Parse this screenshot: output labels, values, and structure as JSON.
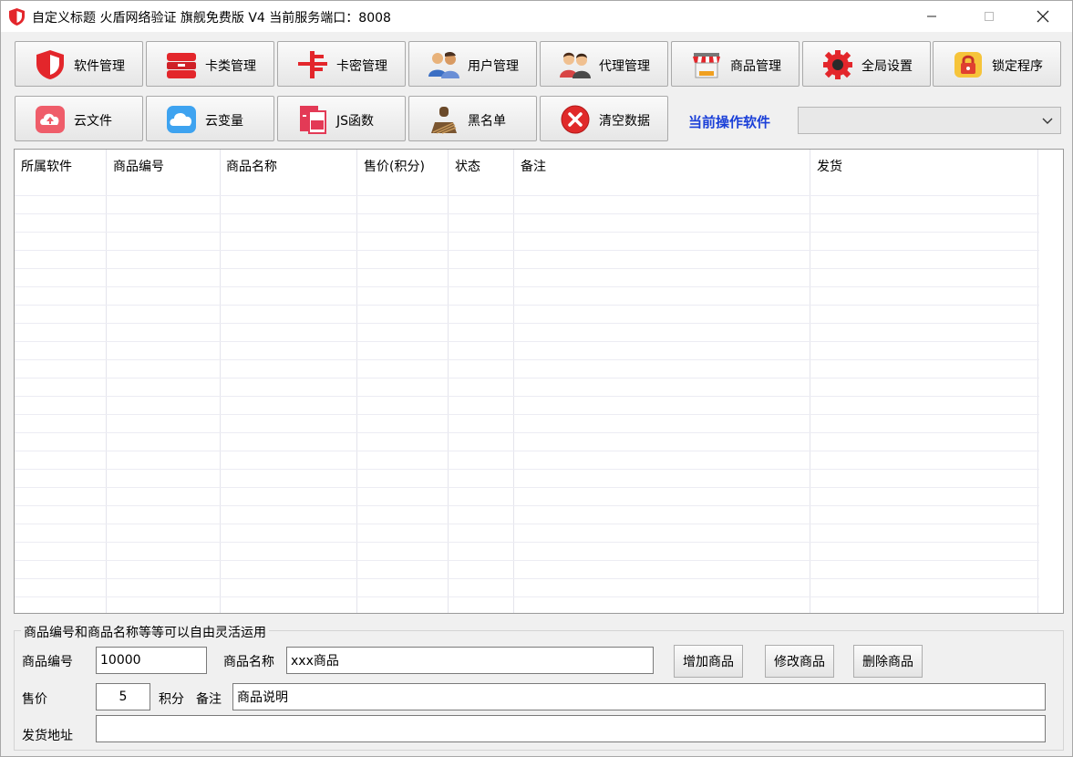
{
  "window": {
    "title": "自定义标题 火盾网络验证 旗舰免费版 V4    当前服务端口：8008"
  },
  "toolbar": {
    "row1": [
      {
        "label": "软件管理",
        "icon": "shield-icon"
      },
      {
        "label": "卡类管理",
        "icon": "card-stack-icon"
      },
      {
        "label": "卡密管理",
        "icon": "card-char-icon"
      },
      {
        "label": "用户管理",
        "icon": "users-icon"
      },
      {
        "label": "代理管理",
        "icon": "agents-icon"
      },
      {
        "label": "商品管理",
        "icon": "shop-icon"
      },
      {
        "label": "全局设置",
        "icon": "gear-icon"
      },
      {
        "label": "锁定程序",
        "icon": "lock-icon"
      }
    ],
    "row2": [
      {
        "label": "云文件",
        "icon": "cloud-upload-icon"
      },
      {
        "label": "云变量",
        "icon": "cloud-icon"
      },
      {
        "label": "JS函数",
        "icon": "js-file-icon"
      },
      {
        "label": "黑名单",
        "icon": "blacklist-person-icon"
      },
      {
        "label": "清空数据",
        "icon": "clear-x-icon"
      }
    ],
    "current_software_label": "当前操作软件",
    "current_software_value": ""
  },
  "table": {
    "columns": [
      "所属软件",
      "商品编号",
      "商品名称",
      "售价(积分)",
      "状态",
      "备注",
      "发货"
    ],
    "rows": []
  },
  "form": {
    "group_title": "商品编号和商品名称等等可以自由灵活运用",
    "product_id_label": "商品编号",
    "product_id_value": "10000",
    "product_name_label": "商品名称",
    "product_name_value": "xxx商品",
    "price_label": "售价",
    "price_value": "5",
    "points_label": "积分",
    "remark_label": "备注",
    "remark_value": "商品说明",
    "ship_addr_label": "发货地址",
    "ship_addr_value": "",
    "add_button": "增加商品",
    "edit_button": "修改商品",
    "delete_button": "删除商品"
  },
  "colors": {
    "accent_label": "#1a3fd8",
    "icon_red": "#e3262b"
  }
}
